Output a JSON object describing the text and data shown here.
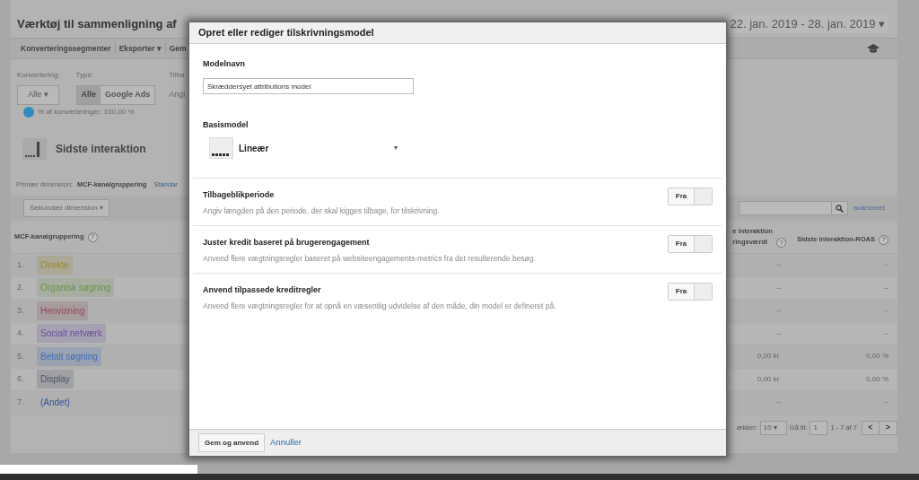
{
  "page": {
    "title": "Værktøj til sammenligning af",
    "date_range": "22. jan. 2019 - 28. jan. 2019 ▾"
  },
  "toolbar": [
    "Konverteringssegmenter",
    "Eksporter ▾",
    "Gem"
  ],
  "filters": {
    "conversion_label": "Konvertering:",
    "conversion_value": "Alle ▾",
    "type_label": "Type:",
    "type_options": [
      {
        "label": "Alle",
        "selected": true
      },
      {
        "label": "Google Ads",
        "selected": false
      }
    ],
    "column_3_label": "Tilba",
    "column_3_value": "Angi",
    "share": "% af konverteringer: 100,00 %"
  },
  "model": "Sidste interaktion",
  "dimension": {
    "label": "Primær dimension:",
    "value": "MCF-kanalgruppering",
    "link": "Standar",
    "secondary": "Sekundær dimension ▾"
  },
  "search": {
    "link": "avanceret"
  },
  "table": {
    "columns": [
      {
        "label": "MCF-kanalgruppering",
        "help": "?"
      },
      {
        "label": "e interaktion\nringsværdi",
        "help": "?"
      },
      {
        "label": "Sidste interaktion-ROAS",
        "help": "?"
      }
    ],
    "rows": [
      {
        "index": "1.",
        "channel": "Direkte",
        "kind": "tag",
        "color": "#9c8a2e",
        "value": "–",
        "roas": "–"
      },
      {
        "index": "2.",
        "channel": "Organisk søgning",
        "kind": "tag",
        "color": "#6b9148",
        "value": "–",
        "roas": "–"
      },
      {
        "index": "3.",
        "channel": "Henvisning",
        "kind": "tag",
        "color": "#8e4a5a",
        "value": "–",
        "roas": "–"
      },
      {
        "index": "4.",
        "channel": "Socialt netværk",
        "kind": "tag",
        "color": "#6a4f9e",
        "value": "–",
        "roas": "–"
      },
      {
        "index": "5.",
        "channel": "Betalt søgning",
        "kind": "tag",
        "color": "#3f6fb8",
        "value": "0,00 kr.",
        "roas": "0,00 %"
      },
      {
        "index": "6.",
        "channel": "Display",
        "kind": "tag",
        "color": "#4a5266",
        "value": "0,00 kr.",
        "roas": "0,00 %"
      },
      {
        "index": "7.",
        "channel": "(Andet)",
        "kind": "link",
        "color": "#2f5696",
        "value": "–",
        "roas": "–"
      }
    ]
  },
  "pagination": {
    "rows_label": "ækker:",
    "rows_value": "10 ▾",
    "goto_label": "Gå til:",
    "goto_value": "1",
    "range": "1 - 7 af 7",
    "prev": "<",
    "next": ">"
  },
  "dialog": {
    "title": "Opret eller rediger tilskrivningsmodel",
    "name_label": "Modelnavn",
    "name_value": "Skræddersyet attributions model",
    "base_label": "Basismodel",
    "base_value": "Lineær",
    "base_caret": "▾",
    "settings": [
      {
        "title": "Tilbageblikperiode",
        "description": "Angiv længden på den periode, der skal kigges tilbage, for tilskrivning.",
        "toggle": "Fra",
        "on": false
      },
      {
        "title": "Juster kredit baseret på brugerengagement",
        "description": "Anvend flere vægtningsregler baseret på websiteengagements-metrics fra det resulterende besøg.",
        "toggle": "Fra",
        "on": false
      },
      {
        "title": "Anvend tilpassede kreditregler",
        "description": "Anvend flere vægtningsregler for at opnå en væsentlig udvidelse af den måde, din model er defineret på.",
        "toggle": "Fra",
        "on": false
      }
    ],
    "save": "Gem og anvend",
    "cancel": "Annuller"
  }
}
